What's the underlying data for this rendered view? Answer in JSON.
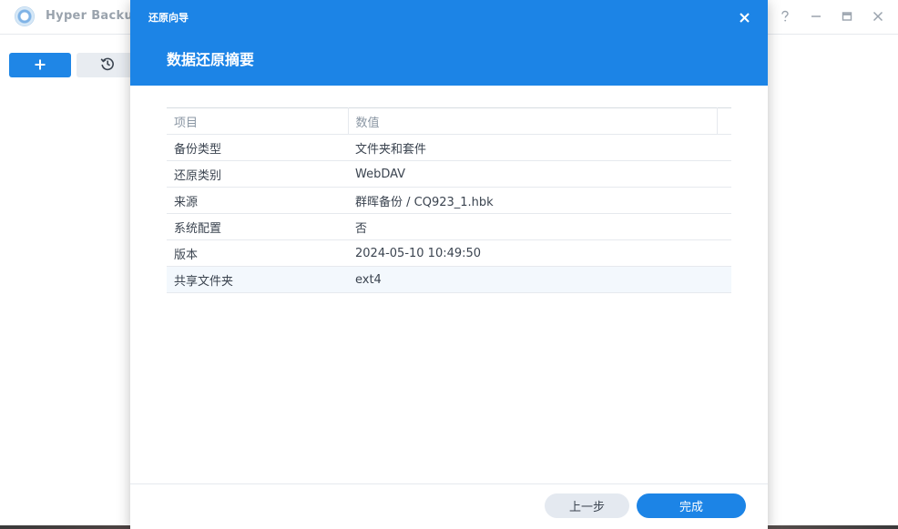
{
  "app": {
    "title": "Hyper Backup",
    "window_controls": [
      "help-icon",
      "minimize-icon",
      "maximize-icon",
      "close-icon"
    ]
  },
  "toolbar": {
    "add_icon": "plus-icon",
    "history_icon": "history-icon"
  },
  "dialog": {
    "caption": "还原向导",
    "heading": "数据还原摘要",
    "table": {
      "headers": [
        "项目",
        "数值"
      ],
      "rows": [
        {
          "item": "备份类型",
          "value": "文件夹和套件"
        },
        {
          "item": "还原类别",
          "value": "WebDAV"
        },
        {
          "item": "来源",
          "value": "群晖备份 / CQ923_1.hbk"
        },
        {
          "item": "系统配置",
          "value": "否"
        },
        {
          "item": "版本",
          "value": "2024-05-10 10:49:50"
        },
        {
          "item": "共享文件夹",
          "value": "ext4"
        }
      ]
    },
    "buttons": {
      "prev": "上一步",
      "finish": "完成"
    }
  },
  "colors": {
    "accent": "#1c84e6",
    "selected_row": "#f3f8fd"
  }
}
